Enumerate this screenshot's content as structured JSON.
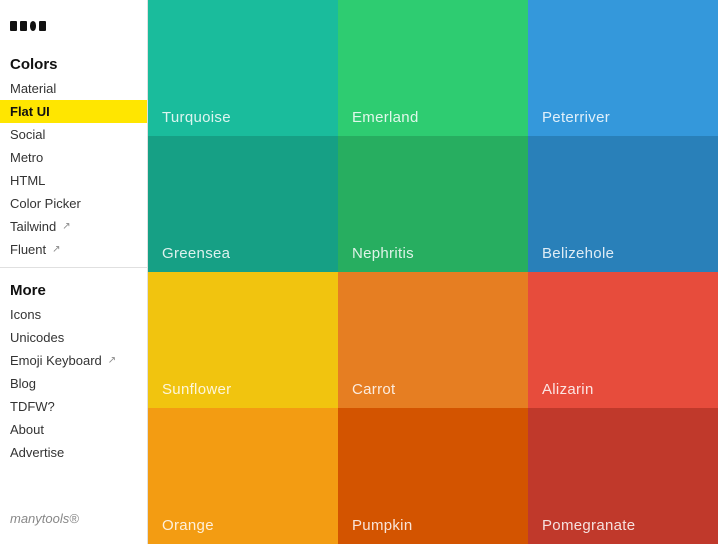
{
  "logo": {
    "alt": "MOI logo"
  },
  "sidebar": {
    "colors_header": "Colors",
    "more_header": "More",
    "items_colors": [
      {
        "label": "Material",
        "active": false,
        "arrow": false
      },
      {
        "label": "Flat UI",
        "active": true,
        "arrow": false
      },
      {
        "label": "Social",
        "active": false,
        "arrow": false
      },
      {
        "label": "Metro",
        "active": false,
        "arrow": false
      },
      {
        "label": "HTML",
        "active": false,
        "arrow": false
      },
      {
        "label": "Color Picker",
        "active": false,
        "arrow": false
      },
      {
        "label": "Tailwind",
        "active": false,
        "arrow": true
      },
      {
        "label": "Fluent",
        "active": false,
        "arrow": true
      }
    ],
    "items_more": [
      {
        "label": "Icons",
        "active": false,
        "arrow": false
      },
      {
        "label": "Unicodes",
        "active": false,
        "arrow": false
      },
      {
        "label": "Emoji Keyboard",
        "active": false,
        "arrow": true
      },
      {
        "label": "Blog",
        "active": false,
        "arrow": false
      },
      {
        "label": "TDFW?",
        "active": false,
        "arrow": false
      },
      {
        "label": "About",
        "active": false,
        "arrow": false
      },
      {
        "label": "Advertise",
        "active": false,
        "arrow": false
      }
    ],
    "manytools": "manytools®"
  },
  "colors": [
    {
      "name": "Turquoise",
      "bg": "#1ABC9C"
    },
    {
      "name": "Emerland",
      "bg": "#2ECC71"
    },
    {
      "name": "Peterriver",
      "bg": "#3498DB"
    },
    {
      "name": "Greensea",
      "bg": "#16A085"
    },
    {
      "name": "Nephritis",
      "bg": "#27AE60"
    },
    {
      "name": "Belizehole",
      "bg": "#2980B9"
    },
    {
      "name": "Sunflower",
      "bg": "#F1C40F"
    },
    {
      "name": "Carrot",
      "bg": "#E67E22"
    },
    {
      "name": "Alizarin",
      "bg": "#E74C3C"
    },
    {
      "name": "Orange",
      "bg": "#F39C12"
    },
    {
      "name": "Pumpkin",
      "bg": "#D35400"
    },
    {
      "name": "Pomegranate",
      "bg": "#C0392B"
    }
  ]
}
